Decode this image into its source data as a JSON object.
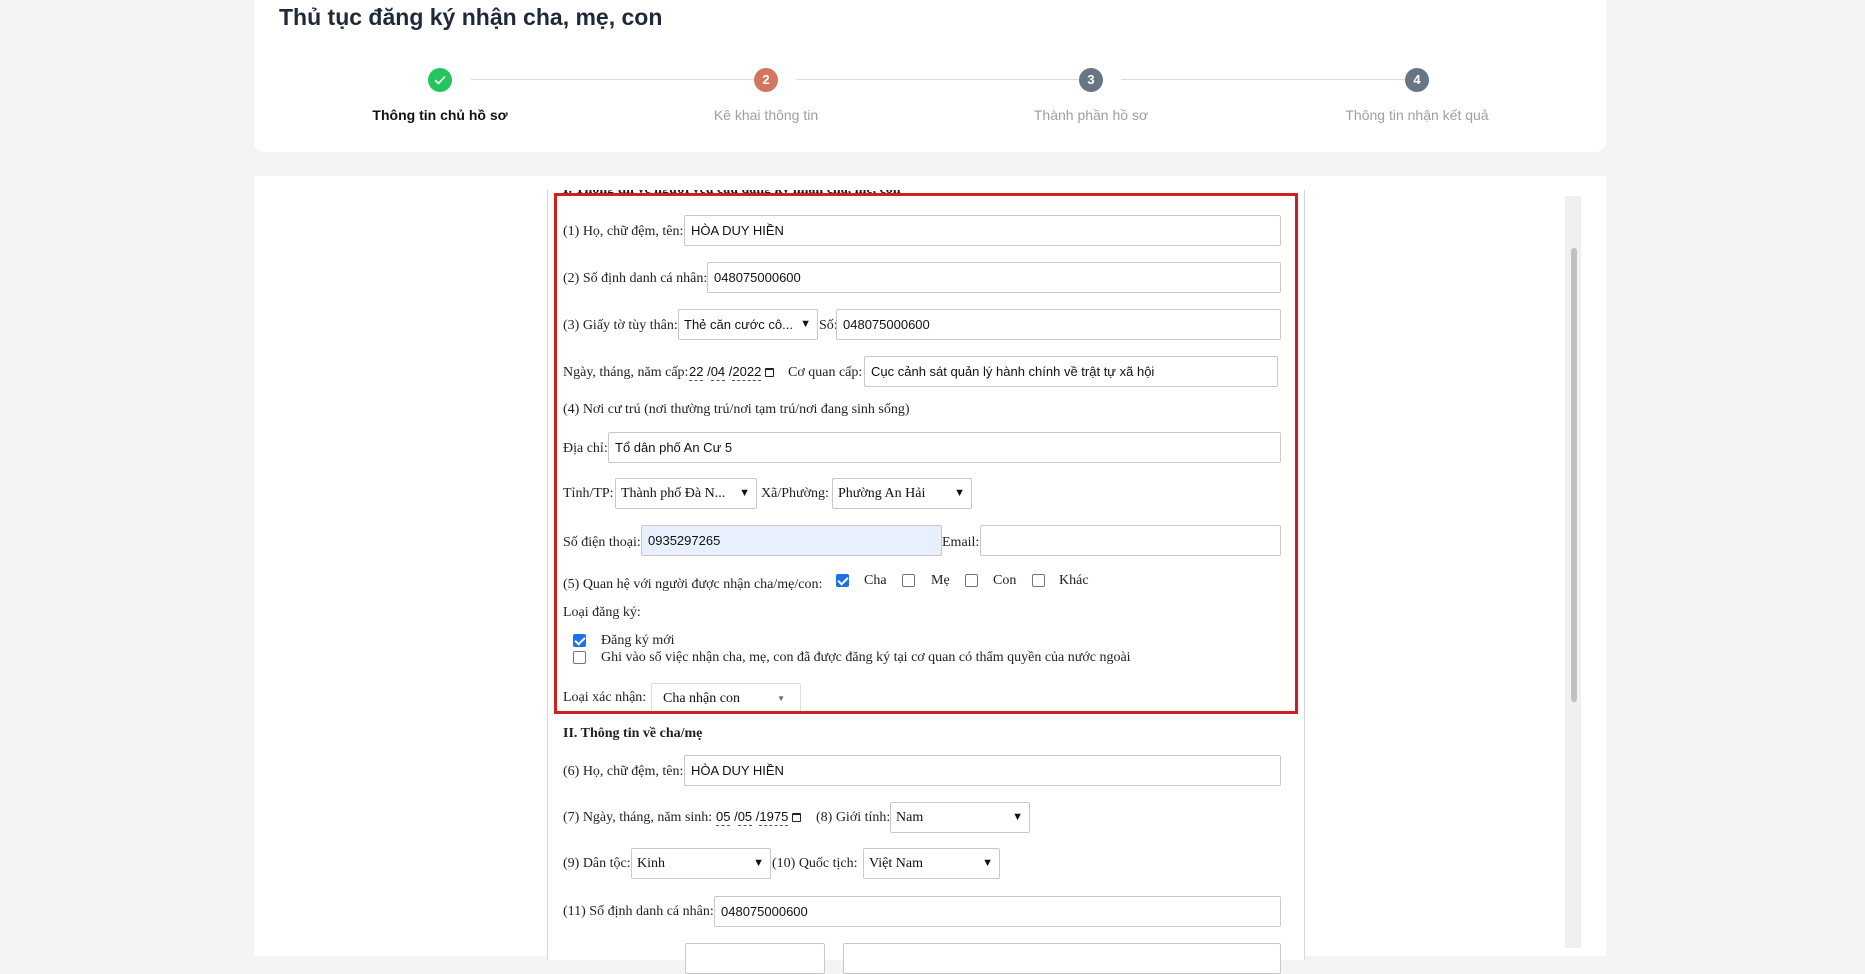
{
  "header": {
    "title": "Thủ tục đăng ký nhận cha, mẹ, con"
  },
  "steps": [
    {
      "number": "✓",
      "label": "Thông tin chủ hồ sơ",
      "state": "done",
      "color": "#22c55e"
    },
    {
      "number": "2",
      "label": "Kê khai thông tin",
      "state": "current",
      "color": "#d2775b"
    },
    {
      "number": "3",
      "label": "Thành phần hồ sơ",
      "state": "pending",
      "color": "#687585"
    },
    {
      "number": "4",
      "label": "Thông tin nhận kết quả",
      "state": "pending",
      "color": "#687585"
    }
  ],
  "section1": {
    "heading_partial": "I. Thông tin về người yêu cầu đăng ký nhận cha, mẹ, con",
    "full_name_label": "(1) Họ, chữ đệm, tên:",
    "full_name_value": "HÒA DUY HIỀN",
    "id_number_label": "(2) Số định danh cá nhân:",
    "id_number_value": "048075000600",
    "doc_label": "(3) Giấy tờ tùy thân:",
    "doc_type_value": "Thẻ căn cước cô...",
    "doc_no_label": "Số:",
    "doc_no_value": "048075000600",
    "issue_date_label": "Ngày, tháng, năm cấp:",
    "issue_day": "22",
    "issue_month": "04",
    "issue_year": "2022",
    "issue_place_label": "Cơ quan cấp:",
    "issue_place_value": "Cục cảnh sát quản lý hành chính về trật tự xã hội",
    "residence_label": "(4) Nơi cư trú (nơi thường trú/nơi tạm trú/nơi đang sinh sống)",
    "address_label": "Địa chỉ:",
    "address_value": "Tổ dân phố An Cư 5",
    "province_label": "Tỉnh/TP:",
    "province_value": "Thành phố Đà N...",
    "ward_label": "Xã/Phường:",
    "ward_value": "Phường An Hải",
    "phone_label": "Số điện thoại:",
    "phone_value": "0935297265",
    "email_label": "Email:",
    "email_value": "",
    "relation_label": "(5) Quan hệ với người được nhận cha/mẹ/con:",
    "relation_options": [
      {
        "label": "Cha",
        "checked": true
      },
      {
        "label": "Mẹ",
        "checked": false
      },
      {
        "label": "Con",
        "checked": false
      },
      {
        "label": "Khác",
        "checked": false
      }
    ],
    "reg_type_label": "Loại đăng ký:",
    "reg_options": [
      {
        "label": "Đăng ký mới",
        "checked": true
      },
      {
        "label": "Ghi vào sổ việc nhận cha, mẹ, con đã được đăng ký tại cơ quan có thẩm quyền của nước ngoài",
        "checked": false
      }
    ],
    "confirm_type_label": "Loại xác nhận:",
    "confirm_type_value": "Cha nhận con"
  },
  "section2": {
    "heading": "II. Thông tin về cha/mẹ",
    "full_name_label": "(6) Họ, chữ đệm, tên:",
    "full_name_value": "HÒA DUY HIỀN",
    "dob_label": "(7) Ngày, tháng, năm sinh:",
    "dob_day": "05",
    "dob_month": "05",
    "dob_year": "1975",
    "gender_label": "(8) Giới tính:",
    "gender_value": "Nam",
    "ethnic_label": "(9) Dân tộc:",
    "ethnic_value": "Kinh",
    "nationality_label": "(10) Quốc tịch:",
    "nationality_value": "Việt Nam",
    "id_number_label": "(11) Số định danh cá nhân:",
    "id_number_value": "048075000600"
  }
}
